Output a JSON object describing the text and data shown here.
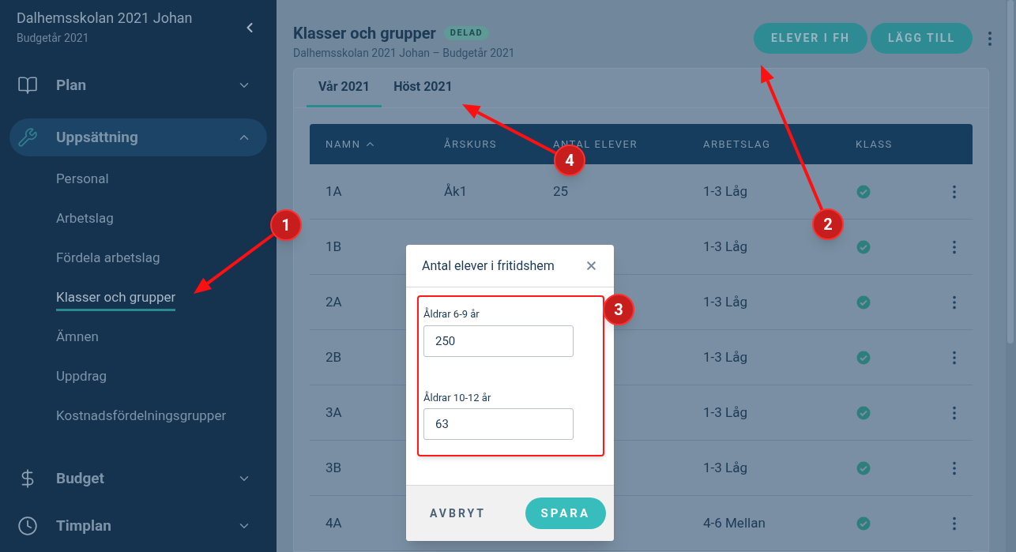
{
  "sidebar": {
    "title": "Dalhemsskolan 2021 Johan",
    "subtitle": "Budgetår 2021",
    "items": [
      {
        "label": "Plan",
        "expanded": false,
        "selected": false
      },
      {
        "label": "Uppsättning",
        "expanded": true,
        "selected": true,
        "children": [
          {
            "label": "Personal",
            "selected": false
          },
          {
            "label": "Arbetslag",
            "selected": false
          },
          {
            "label": "Fördela arbetslag",
            "selected": false
          },
          {
            "label": "Klasser och grupper",
            "selected": true
          },
          {
            "label": "Ämnen",
            "selected": false
          },
          {
            "label": "Uppdrag",
            "selected": false
          },
          {
            "label": "Kostnadsfördelningsgrupper",
            "selected": false
          }
        ]
      },
      {
        "label": "Budget",
        "expanded": false,
        "selected": false
      },
      {
        "label": "Timplan",
        "expanded": false,
        "selected": false
      }
    ]
  },
  "page": {
    "title": "Klasser och grupper",
    "badge": "DELAD",
    "subtitle": "Dalhemsskolan 2021 Johan – Budgetår 2021",
    "buttons": [
      "ELEVER I FH",
      "LÄGG TILL"
    ]
  },
  "tabs": [
    {
      "label": "Vår 2021",
      "selected": true
    },
    {
      "label": "Höst 2021",
      "selected": false
    }
  ],
  "table": {
    "columns": [
      {
        "label": "NAMN",
        "sorted": true
      },
      {
        "label": "ÅRSKURS",
        "sorted": false
      },
      {
        "label": "ANTAL ELEVER",
        "sorted": false
      },
      {
        "label": "ARBETSLAG",
        "sorted": false
      },
      {
        "label": "KLASS",
        "sorted": false
      }
    ],
    "rows": [
      {
        "name": "1A",
        "grade": "Åk1",
        "students": "25",
        "team": "1-3 Låg",
        "class": true
      },
      {
        "name": "1B",
        "team": "1-3 Låg",
        "class": true
      },
      {
        "name": "2A",
        "team": "1-3 Låg",
        "class": true
      },
      {
        "name": "2B",
        "team": "1-3 Låg",
        "class": true
      },
      {
        "name": "3A",
        "team": "1-3 Låg",
        "class": true
      },
      {
        "name": "3B",
        "team": "1-3 Låg",
        "class": true
      },
      {
        "name": "4A",
        "team": "4-6 Mellan",
        "class": true
      }
    ]
  },
  "dialog": {
    "title": "Antal elever i fritidshem",
    "fields": [
      {
        "label": "Åldrar 6-9 år",
        "value": "250"
      },
      {
        "label": "Åldrar 10-12 år",
        "value": "63"
      }
    ],
    "cancel": "AVBRYT",
    "save": "SPARA"
  },
  "annotations": [
    {
      "number": "1"
    },
    {
      "number": "2"
    },
    {
      "number": "3"
    },
    {
      "number": "4"
    }
  ]
}
